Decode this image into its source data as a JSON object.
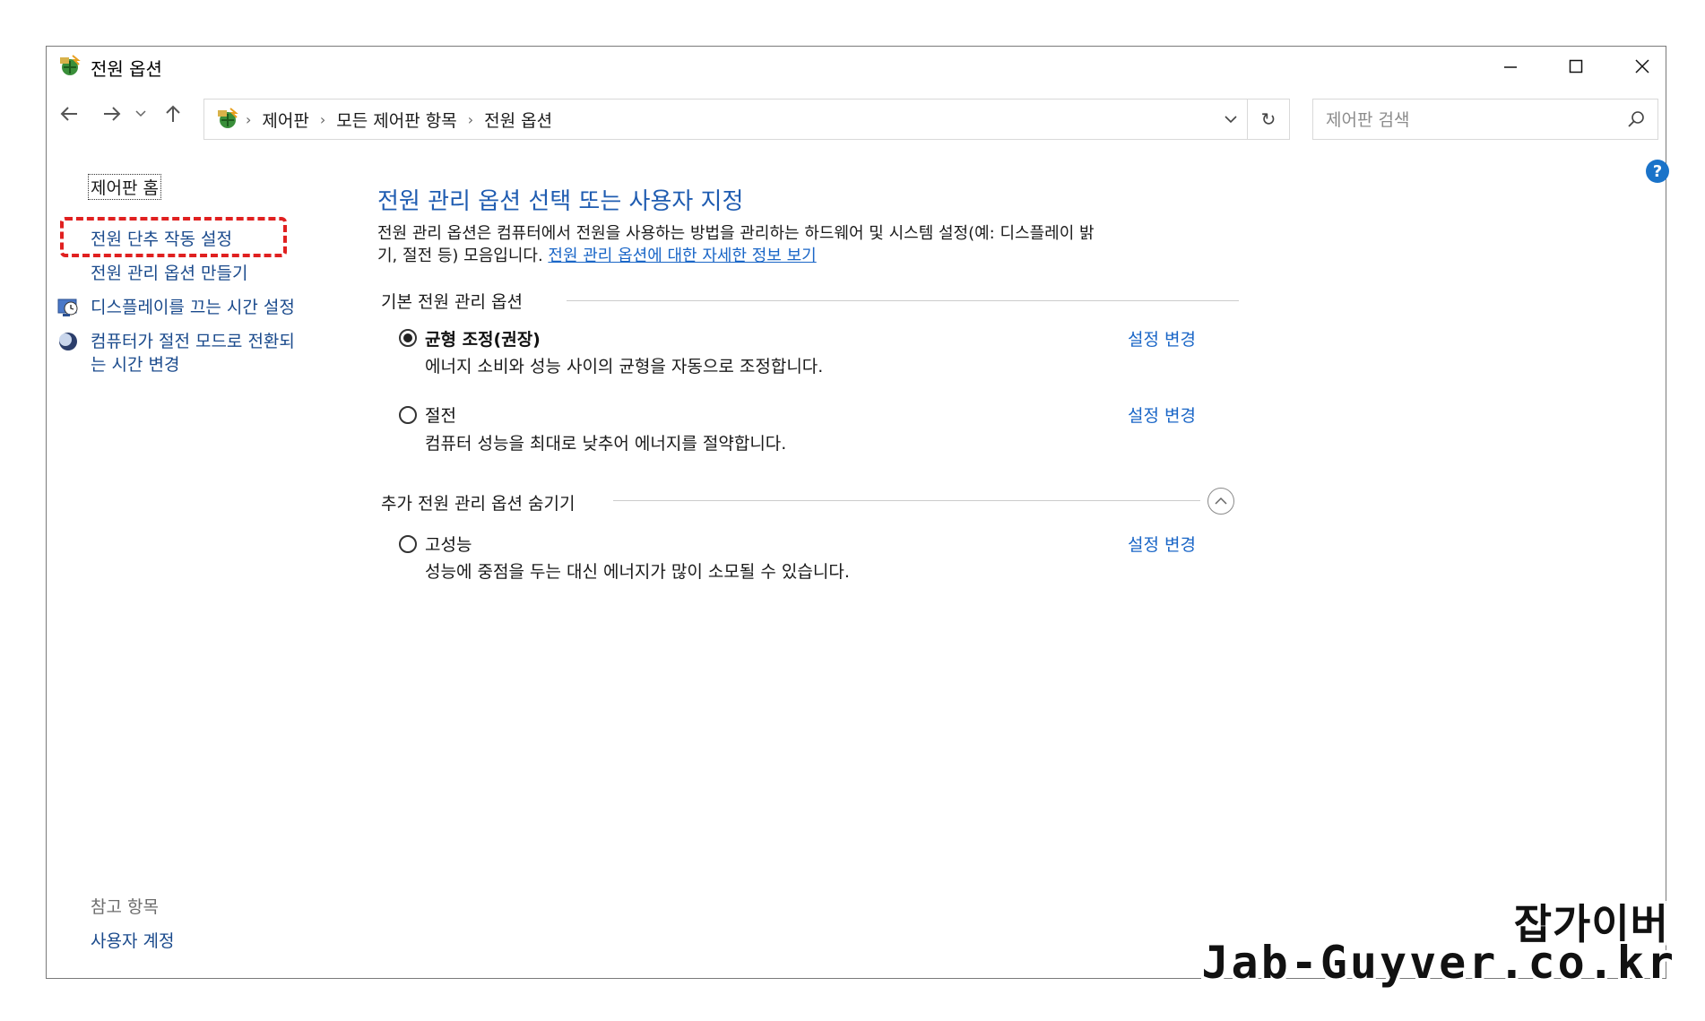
{
  "window": {
    "title": "전원 옵션",
    "controls": {
      "minimize": "minimize",
      "maximize": "maximize",
      "close": "close"
    }
  },
  "address": {
    "crumbs": [
      "제어판",
      "모든 제어판 항목",
      "전원 옵션"
    ],
    "separator": "›",
    "refresh_glyph": "↻"
  },
  "search": {
    "placeholder": "제어판 검색",
    "value": ""
  },
  "help": {
    "glyph": "?"
  },
  "sidebar": {
    "home": "제어판 홈",
    "links": [
      {
        "label": "전원 단추 작동 설정",
        "highlighted": true
      },
      {
        "label": "전원 관리 옵션 만들기"
      },
      {
        "label": "디스플레이를 끄는 시간 설정",
        "icon": "display-clock-icon"
      },
      {
        "label_line1": "컴퓨터가 절전 모드로 전환되",
        "label_line2": "는 시간 변경",
        "icon": "moon-icon"
      }
    ],
    "see_also": {
      "heading": "참고 항목",
      "links": [
        "사용자 계정"
      ]
    }
  },
  "main": {
    "title": "전원 관리 옵션 선택 또는 사용자 지정",
    "description_line1": "전원 관리 옵션은 컴퓨터에서 전원을 사용하는 방법을 관리하는 하드웨어 및 시스템 설정(예: 디스플레이 밝",
    "description_line2": "기, 절전 등) 모음입니다. ",
    "description_link": "전원 관리 옵션에 대한 자세한 정보 보기",
    "basic_section": "기본 전원 관리 옵션",
    "additional_section": "추가 전원 관리 옵션 숨기기",
    "plans": [
      {
        "name": "균형 조정(권장)",
        "description": "에너지 소비와 성능 사이의 균형을 자동으로 조정합니다.",
        "link": "설정 변경",
        "selected": true
      },
      {
        "name": "절전",
        "description": "컴퓨터 성능을 최대로 낮추어 에너지를 절약합니다.",
        "link": "설정 변경",
        "selected": false
      },
      {
        "name": "고성능",
        "description": "성능에 중점을 두는 대신 에너지가 많이 소모될 수 있습니다.",
        "link": "설정 변경",
        "selected": false
      }
    ]
  },
  "watermark": {
    "line1": "잡가이버",
    "line2": "Jab-Guyver.co.kr"
  },
  "colors": {
    "accent": "#1f5cb1",
    "link": "#1a66c7",
    "highlight": "#e02020"
  }
}
